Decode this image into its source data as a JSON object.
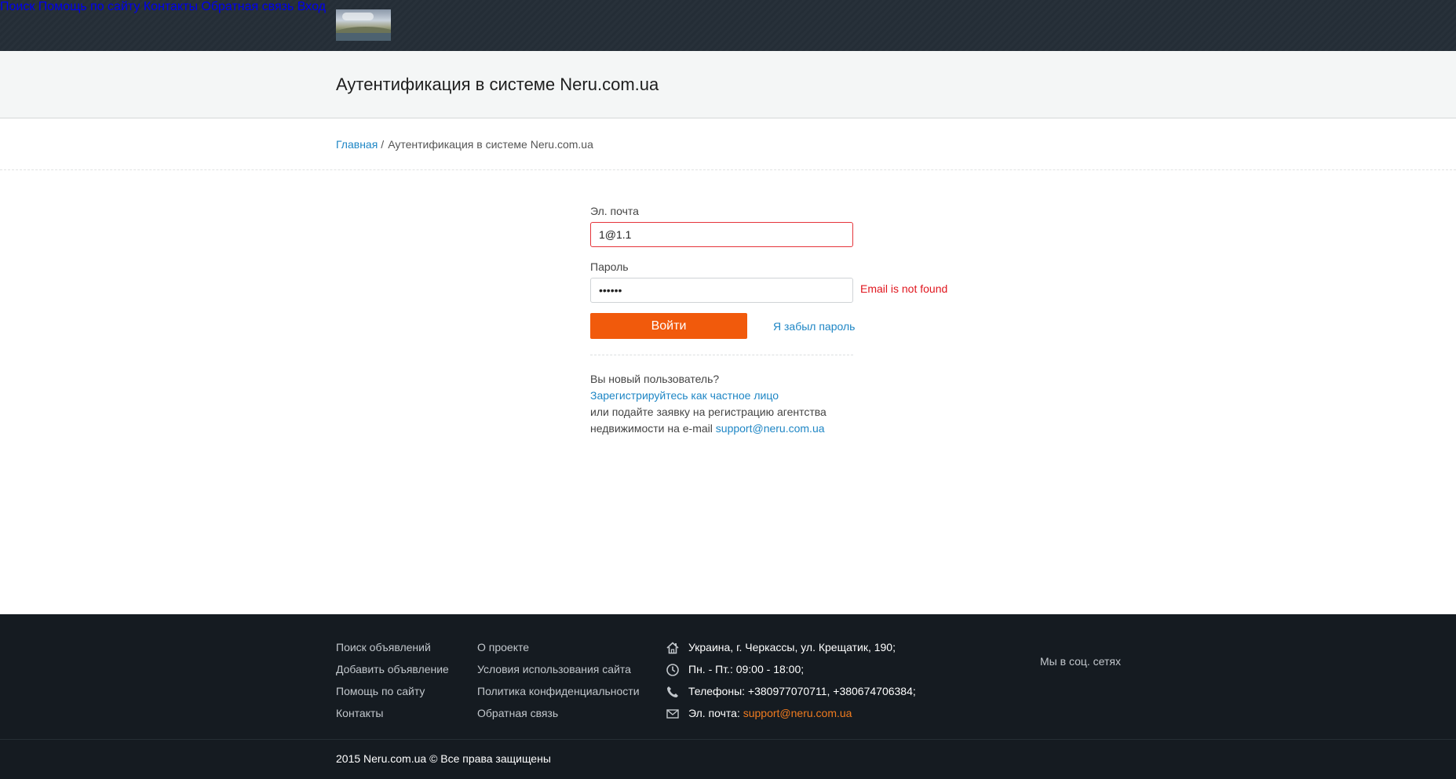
{
  "header": {
    "nav": [
      {
        "label": "Поиск"
      },
      {
        "label": "Помощь по сайту"
      },
      {
        "label": "Контакты"
      },
      {
        "label": "Обратная связь"
      },
      {
        "label": "Вход"
      }
    ]
  },
  "page": {
    "title": "Аутентификация в системе Neru.com.ua"
  },
  "breadcrumb": {
    "home": "Главная",
    "separator": "/",
    "current": "Аутентификация в системе Neru.com.ua"
  },
  "form": {
    "email_label": "Эл. почта",
    "email_value": "1@1.1",
    "password_label": "Пароль",
    "password_value": "123456",
    "error_message": "Email is not found",
    "submit_label": "Войти",
    "forgot_label": "Я забыл пароль",
    "new_user_question": "Вы новый пользователь?",
    "register_link": "Зарегистрируйтесь как частное лицо",
    "agency_line1": "или подайте заявку на регистрацию агентства",
    "agency_line2": "недвижимости на e-mail",
    "agency_email": "support@neru.com.ua"
  },
  "footer": {
    "col1": [
      {
        "label": "Поиск объявлений"
      },
      {
        "label": "Добавить объявление"
      },
      {
        "label": "Помощь по сайту"
      },
      {
        "label": "Контакты"
      }
    ],
    "col2": [
      {
        "label": "О проекте"
      },
      {
        "label": "Условия использования сайта"
      },
      {
        "label": "Политика конфиденциальности"
      },
      {
        "label": "Обратная связь"
      }
    ],
    "contacts": {
      "address": "Украина, г. Черкассы, ул. Крещатик, 190;",
      "hours": "Пн. - Пт.: 09:00 - 18:00;",
      "phones": "Телефоны: +380977070711, +380674706384;",
      "email_label": "Эл. почта:",
      "email": "support@neru.com.ua"
    },
    "social_label": "Мы в соц. сетях",
    "copyright": "2015 Neru.com.ua © Все права защищены"
  },
  "colors": {
    "accent": "#f15a0c",
    "link": "#1e86c5",
    "error": "#e0161e",
    "header_bg": "#242d36",
    "footer_bg": "#151b21"
  },
  "icons": [
    "home-icon",
    "clock-icon",
    "phone-icon",
    "envelope-icon"
  ]
}
